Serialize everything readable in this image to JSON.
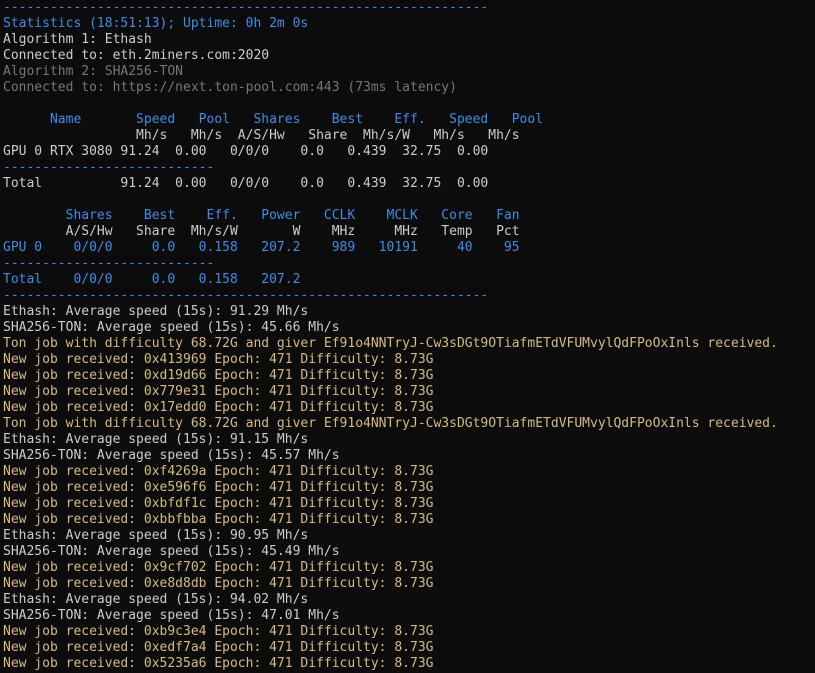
{
  "terminal": {
    "separator": "--------------------------------------------------------------",
    "stats_line": "Statistics (18:51:13); Uptime: 0h 2m 0s",
    "algo1": "Algorithm 1: Ethash",
    "conn1": "Connected to: eth.2miners.com:2020",
    "algo2": "Algorithm 2: SHA256-TON",
    "conn2": "Connected to: https://next.ton-pool.com:443 (73ms latency)",
    "table1": {
      "header1": "      Name       Speed   Pool   Shares    Best    Eff.   Speed   Pool",
      "header2": "                 Mh/s   Mh/s  A/S/Hw   Share  Mh/s/W   Mh/s   Mh/s",
      "row": "GPU 0 RTX 3080 91.24  0.00   0/0/0    0.0   0.439  32.75  0.00",
      "divider": "---------------------------",
      "total": "Total          91.24  0.00   0/0/0    0.0   0.439  32.75  0.00"
    },
    "table2": {
      "header1": "        Shares    Best    Eff.   Power   CCLK    MCLK   Core   Fan",
      "header2": "        A/S/Hw   Share  Mh/s/W       W    MHz     MHz   Temp   Pct",
      "row": "GPU 0    0/0/0     0.0   0.158   207.2    989   10191     40    95",
      "divider": "---------------------------",
      "total": "Total    0/0/0     0.0   0.158   207.2"
    },
    "log": [
      {
        "text": "Ethash: Average speed (15s): 91.29 Mh/s",
        "style": "white"
      },
      {
        "text": "SHA256-TON: Average speed (15s): 45.66 Mh/s",
        "style": "white"
      },
      {
        "text": "Ton job with difficulty 68.72G and giver Ef91o4NNTryJ-Cw3sDGt9OTiafmETdVFUMvylQdFPoOxInls received.",
        "style": "gold"
      },
      {
        "text": "New job received: 0x413969 Epoch: 471 Difficulty: 8.73G",
        "style": "gold"
      },
      {
        "text": "New job received: 0xd19d66 Epoch: 471 Difficulty: 8.73G",
        "style": "gold"
      },
      {
        "text": "New job received: 0x779e31 Epoch: 471 Difficulty: 8.73G",
        "style": "gold"
      },
      {
        "text": "New job received: 0x17edd0 Epoch: 471 Difficulty: 8.73G",
        "style": "gold"
      },
      {
        "text": "Ton job with difficulty 68.72G and giver Ef91o4NNTryJ-Cw3sDGt9OTiafmETdVFUMvylQdFPoOxInls received.",
        "style": "gold"
      },
      {
        "text": "Ethash: Average speed (15s): 91.15 Mh/s",
        "style": "white"
      },
      {
        "text": "SHA256-TON: Average speed (15s): 45.57 Mh/s",
        "style": "white"
      },
      {
        "text": "New job received: 0xf4269a Epoch: 471 Difficulty: 8.73G",
        "style": "gold"
      },
      {
        "text": "New job received: 0xe596f6 Epoch: 471 Difficulty: 8.73G",
        "style": "gold"
      },
      {
        "text": "New job received: 0xbfdf1c Epoch: 471 Difficulty: 8.73G",
        "style": "gold"
      },
      {
        "text": "New job received: 0xbbfbba Epoch: 471 Difficulty: 8.73G",
        "style": "gold"
      },
      {
        "text": "Ethash: Average speed (15s): 90.95 Mh/s",
        "style": "white"
      },
      {
        "text": "SHA256-TON: Average speed (15s): 45.49 Mh/s",
        "style": "white"
      },
      {
        "text": "New job received: 0x9cf702 Epoch: 471 Difficulty: 8.73G",
        "style": "gold"
      },
      {
        "text": "New job received: 0xe8d8db Epoch: 471 Difficulty: 8.73G",
        "style": "gold"
      },
      {
        "text": "Ethash: Average speed (15s): 94.02 Mh/s",
        "style": "white"
      },
      {
        "text": "SHA256-TON: Average speed (15s): 47.01 Mh/s",
        "style": "white"
      },
      {
        "text": "New job received: 0xb9c3e4 Epoch: 471 Difficulty: 8.73G",
        "style": "gold"
      },
      {
        "text": "New job received: 0xedf7a4 Epoch: 471 Difficulty: 8.73G",
        "style": "gold"
      },
      {
        "text": "New job received: 0x5235a6 Epoch: 471 Difficulty: 8.73G",
        "style": "gold"
      }
    ]
  },
  "colors": {
    "background": "#0c0c0c",
    "blue": "#3b8eea",
    "white": "#cccccc",
    "gray": "#767676",
    "gold": "#d7ba7d"
  }
}
